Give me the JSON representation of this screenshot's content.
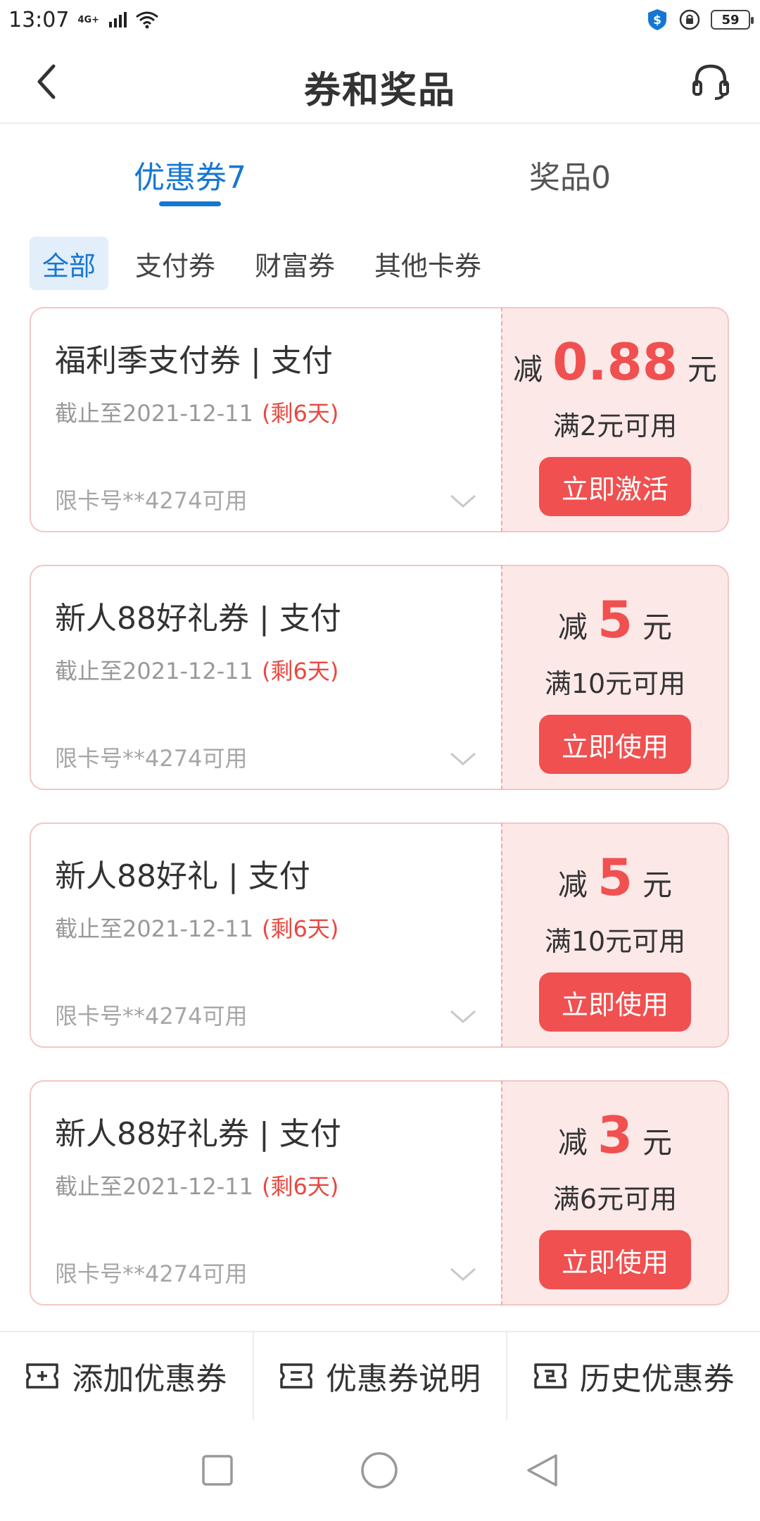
{
  "status": {
    "time": "13:07",
    "network": "4G+",
    "battery": "59"
  },
  "header": {
    "title": "券和奖品"
  },
  "tabs": [
    {
      "label": "优惠券7"
    },
    {
      "label": "奖品0"
    }
  ],
  "filters": [
    "全部",
    "支付券",
    "财富券",
    "其他卡券"
  ],
  "coupons": [
    {
      "name": "福利季支付券 | 支付",
      "expire": "截止至2021-12-11",
      "remain": "(剩6天)",
      "limit": "限卡号**4274可用",
      "prefix": "减",
      "amount": "0.88",
      "unit": "元",
      "condition": "满2元可用",
      "action": "立即激活"
    },
    {
      "name": "新人88好礼券 | 支付",
      "expire": "截止至2021-12-11",
      "remain": "(剩6天)",
      "limit": "限卡号**4274可用",
      "prefix": "减",
      "amount": "5",
      "unit": "元",
      "condition": "满10元可用",
      "action": "立即使用"
    },
    {
      "name": "新人88好礼 | 支付",
      "expire": "截止至2021-12-11",
      "remain": "(剩6天)",
      "limit": "限卡号**4274可用",
      "prefix": "减",
      "amount": "5",
      "unit": "元",
      "condition": "满10元可用",
      "action": "立即使用"
    },
    {
      "name": "新人88好礼券 | 支付",
      "expire": "截止至2021-12-11",
      "remain": "(剩6天)",
      "limit": "限卡号**4274可用",
      "prefix": "减",
      "amount": "3",
      "unit": "元",
      "condition": "满6元可用",
      "action": "立即使用"
    }
  ],
  "bottom": {
    "add": "添加优惠券",
    "info": "优惠券说明",
    "history": "历史优惠券"
  },
  "colors": {
    "accent": "#1677d2",
    "coupon_red": "#f05050",
    "coupon_bg": "#fde8e8"
  }
}
